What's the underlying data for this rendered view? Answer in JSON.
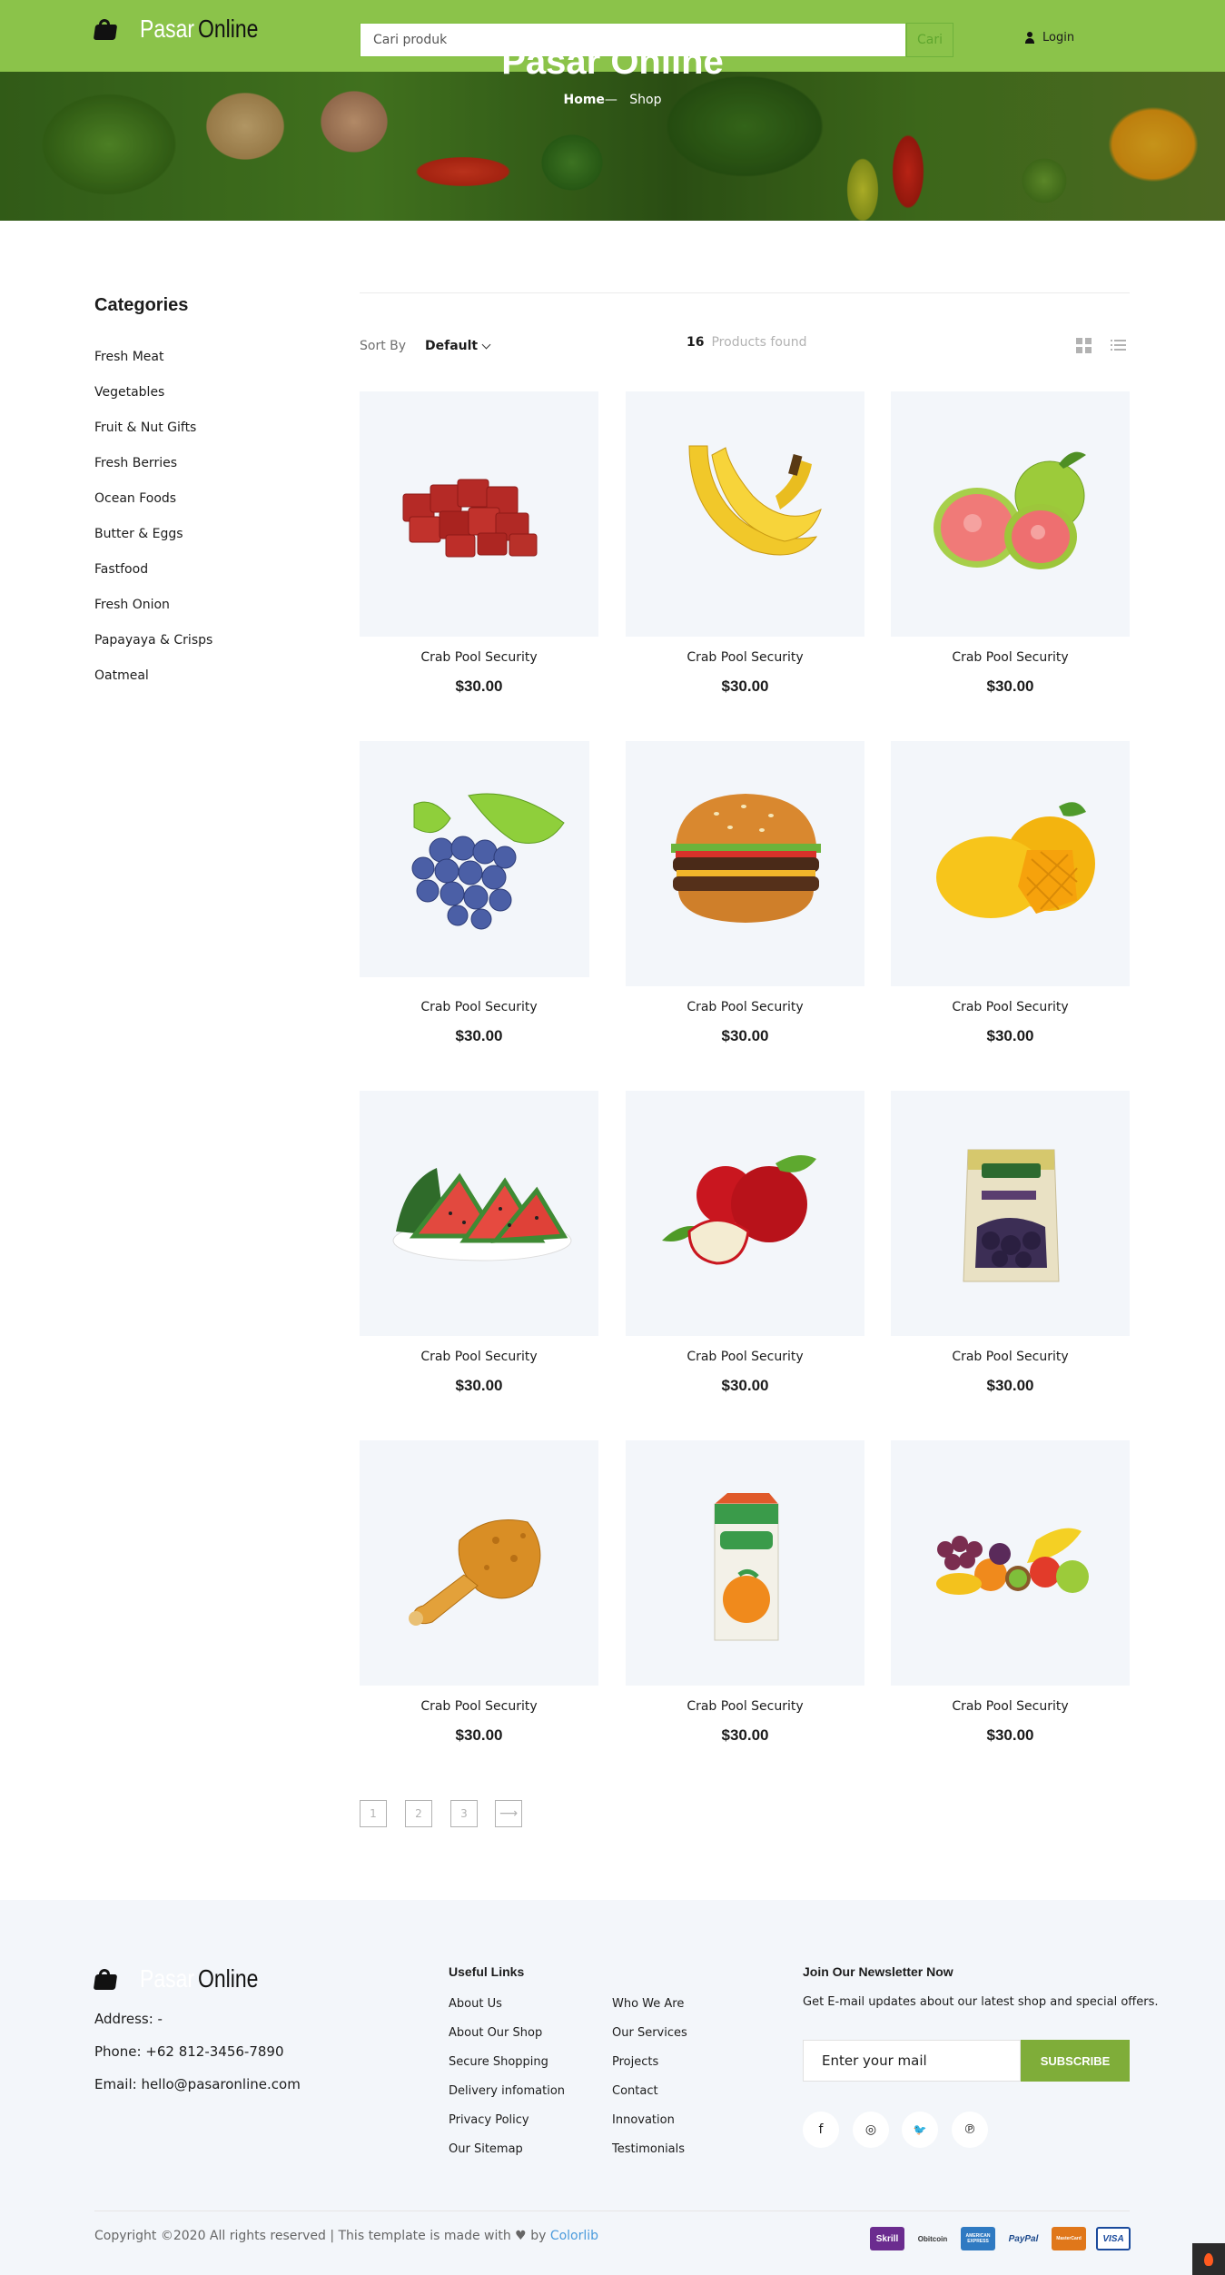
{
  "header": {
    "logo_word1": "Pasar",
    "logo_word2": "Online",
    "search_placeholder": "Cari produk",
    "search_button": "Cari",
    "login_label": "Login",
    "colors": {
      "header_bg": "#8bc34a",
      "accent": "#7fad39"
    }
  },
  "hero": {
    "title": "Pasar Online",
    "breadcrumb_home": "Home",
    "breadcrumb_sep": "—",
    "breadcrumb_current": "Shop"
  },
  "sidebar": {
    "title": "Categories",
    "items": [
      {
        "label": "Fresh Meat"
      },
      {
        "label": "Vegetables"
      },
      {
        "label": "Fruit & Nut Gifts"
      },
      {
        "label": "Fresh Berries"
      },
      {
        "label": "Ocean Foods"
      },
      {
        "label": "Butter & Eggs"
      },
      {
        "label": "Fastfood"
      },
      {
        "label": "Fresh Onion"
      },
      {
        "label": "Papayaya & Crisps"
      },
      {
        "label": "Oatmeal"
      }
    ]
  },
  "toolbar": {
    "sort_label": "Sort By",
    "sort_value": "Default",
    "count": "16",
    "count_label": "Products found",
    "grid_view_icon": "grid-icon",
    "list_view_icon": "list-icon"
  },
  "products": [
    {
      "name": "Crab Pool Security",
      "price": "$30.00",
      "image": "meat-cubes"
    },
    {
      "name": "Crab Pool Security",
      "price": "$30.00",
      "image": "bananas"
    },
    {
      "name": "Crab Pool Security",
      "price": "$30.00",
      "image": "guava"
    },
    {
      "name": "Crab Pool Security",
      "price": "$30.00",
      "image": "grapes"
    },
    {
      "name": "Crab Pool Security",
      "price": "$30.00",
      "image": "hamburger"
    },
    {
      "name": "Crab Pool Security",
      "price": "$30.00",
      "image": "mango"
    },
    {
      "name": "Crab Pool Security",
      "price": "$30.00",
      "image": "watermelon"
    },
    {
      "name": "Crab Pool Security",
      "price": "$30.00",
      "image": "apples"
    },
    {
      "name": "Crab Pool Security",
      "price": "$30.00",
      "image": "dried-plums-pack"
    },
    {
      "name": "Crab Pool Security",
      "price": "$30.00",
      "image": "fried-chicken"
    },
    {
      "name": "Crab Pool Security",
      "price": "$30.00",
      "image": "juice-carton"
    },
    {
      "name": "Crab Pool Security",
      "price": "$30.00",
      "image": "fruit-assortment"
    }
  ],
  "pagination": {
    "pages": [
      "1",
      "2",
      "3"
    ],
    "next_icon": "arrow-right-icon"
  },
  "footer": {
    "logo_word1": "Pasar",
    "logo_word2": "Online",
    "address": "Address: -",
    "phone": "Phone: +62 812-3456-7890",
    "email": "Email: hello@pasaronline.com",
    "links_title": "Useful Links",
    "links_col1": [
      "About Us",
      "About Our Shop",
      "Secure Shopping",
      "Delivery infomation",
      "Privacy Policy",
      "Our Sitemap"
    ],
    "links_col2": [
      "Who We Are",
      "Our Services",
      "Projects",
      "Contact",
      "Innovation",
      "Testimonials"
    ],
    "newsletter_title": "Join Our Newsletter Now",
    "newsletter_text": "Get E-mail updates about our latest shop and special offers.",
    "newsletter_placeholder": "Enter your mail",
    "subscribe_label": "SUBSCRIBE",
    "social": [
      {
        "icon": "facebook-icon",
        "glyph": "f"
      },
      {
        "icon": "instagram-icon",
        "glyph": "◎"
      },
      {
        "icon": "twitter-icon",
        "glyph": "🐦"
      },
      {
        "icon": "pinterest-icon",
        "glyph": "℗"
      }
    ],
    "copyright_pre": "Copyright ©2020 All rights reserved | This template is made with",
    "copyright_by": "by",
    "copyright_link": "Colorlib",
    "payments": [
      "Skrill",
      "Obitcoin",
      "AMERICAN EXPRESS",
      "PayPal",
      "MasterCard",
      "VISA"
    ]
  }
}
